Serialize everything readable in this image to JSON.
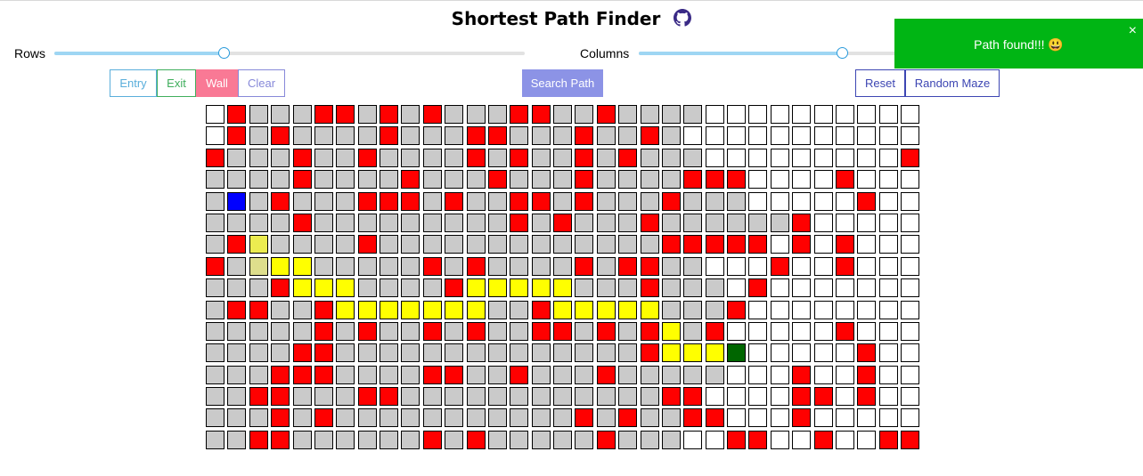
{
  "app": {
    "title": "Shortest Path Finder",
    "github_icon": "github-icon"
  },
  "sliders": {
    "rows": {
      "label": "Rows",
      "value_fraction": 0.36
    },
    "columns": {
      "label": "Columns",
      "value_fraction": 0.67
    }
  },
  "modes": {
    "entry": "Entry",
    "exit": "Exit",
    "wall": "Wall",
    "clear": "Clear",
    "active": "wall"
  },
  "actions": {
    "search": "Search Path",
    "reset": "Reset",
    "random_maze": "Random Maze"
  },
  "toast": {
    "message": "Path found!!! 😃",
    "close": "×"
  },
  "grid": {
    "legend": {
      "W": "unvisited",
      "G": "visited",
      "R": "wall",
      "Y": "path",
      "B": "entry",
      "K": "exit",
      "L": "path-near-entry",
      "M": "path-near-entry-2"
    },
    "colors": {
      "W": "#ffffff",
      "G": "#cacaca",
      "R": "#ff0000",
      "Y": "#ffff00",
      "B": "#0000ff",
      "K": "#006600",
      "L": "#dede8c",
      "M": "#ecec50"
    },
    "rows": [
      "WRGGGRRGRGRGGGRRGGRGGGGWWWWWWWWWW",
      "WRGRGGGGRGGGRRGGGRGGRGWWWWWWWWWWW",
      "RGGGRGGRGGGGRGRGGRGRGGGWWWWWWWWWR",
      "GGGGRGGGGRGGGRGGGRGGGGRRRWWWWRWWW",
      "GBGRGGGRRRGRGGRRGRGGGRGGGWWWWWRWW",
      "GGGGRGGGGGGGGGRGRGGGRGGGGGGRWWWWW",
      "GRMGGGGRGGGGGGGGGGGGGRRRRRWRWRWWW",
      "RGLYYGGGGGRGRGGGGRGRRGGWWWRWWRWWW",
      "GGGRYYYGGGGRYYYYYGGGRGGGWRWWWWWWW",
      "GRRGGRYYYYYYYGGRYYYYYGGGRWWWWWWWW",
      "GGGGGRGRGGRGRGGRRGRGRYGRWWWWWRWWW",
      "GGGGRRGGGGGGGGGGGGGGRYYYKWWWWWRWW",
      "GGGRRRGGGGRRGGRGGGRGGGGGWWWRWWRWW",
      "GGRRGGGRRGGGGGGGGGGGGRRWWWWRRWRWW",
      "GGGRGRGGGGGGGGGGGRGRGGRRWWWRWWWWW",
      "GGRRGGGGGGRGRGGGGGRGGGWWRRWWRWWRR"
    ]
  }
}
